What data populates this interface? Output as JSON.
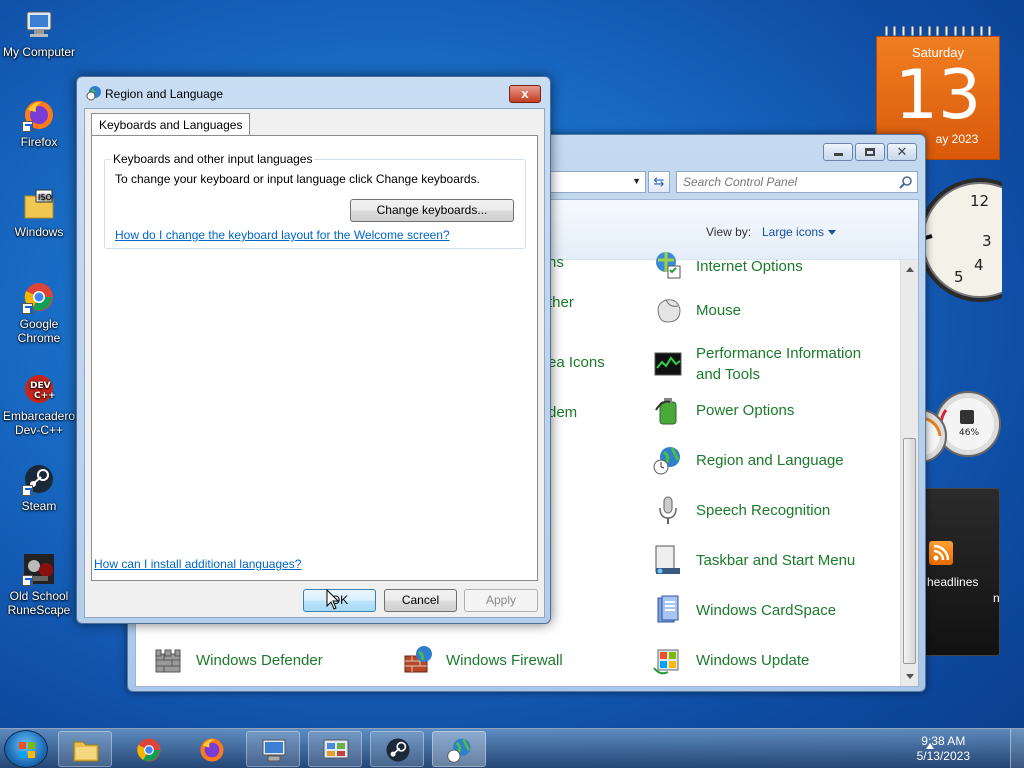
{
  "desktop_icons": [
    {
      "label": "My Computer"
    },
    {
      "label": "Firefox"
    },
    {
      "label": "Windows"
    },
    {
      "label": "Google Chrome"
    },
    {
      "label": "Embarcadero Dev-C++"
    },
    {
      "label": "Steam"
    },
    {
      "label": "Old School RuneScape"
    }
  ],
  "gadgets": {
    "calendar": {
      "weekday": "Saturday",
      "day": "13",
      "month_partial": "ay 2023"
    },
    "clock": {
      "numerals": [
        "12",
        "3",
        "4",
        "5"
      ]
    },
    "meter": {
      "percent": "46%"
    },
    "feed": {
      "label": "headlines",
      "label_partial": "n"
    }
  },
  "control_panel": {
    "search_placeholder": "Search Control Panel",
    "view_by_label": "View by:",
    "view_by_value": "Large icons",
    "partial_items": [
      "ns",
      "ther",
      "ea Icons",
      "dem"
    ],
    "items_right": [
      "Internet Options",
      "Mouse",
      "Performance Information and Tools",
      "Power Options",
      "Region and Language",
      "Speech Recognition",
      "Taskbar and Start Menu",
      "Windows CardSpace",
      "Windows Update"
    ],
    "items_bottom": [
      "Windows Defender",
      "Windows Firewall"
    ]
  },
  "dialog": {
    "title": "Region and Language",
    "close_glyph": "x",
    "tab": "Keyboards and Languages",
    "group_title": "Keyboards and other input languages",
    "group_text": "To change your keyboard or input language click Change keyboards.",
    "change_keyboards": "Change keyboards...",
    "link_welcome": "How do I change the keyboard layout for the Welcome screen?",
    "link_install": "How can I install additional languages?",
    "ok": "OK",
    "cancel": "Cancel",
    "apply": "Apply"
  },
  "taskbar": {
    "time": "9:38 AM",
    "date": "5/13/2023",
    "apps": [
      "explorer",
      "chrome",
      "firefox",
      "remote-desktop",
      "control-panel",
      "steam",
      "region-language"
    ]
  }
}
